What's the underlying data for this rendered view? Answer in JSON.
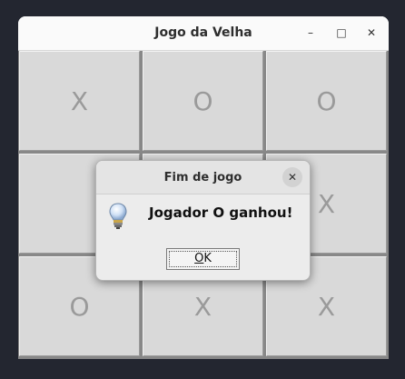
{
  "window": {
    "title": "Jogo da Velha",
    "controls": {
      "minimize": "–",
      "maximize": "□",
      "close": "✕"
    }
  },
  "board": {
    "cells": [
      "X",
      "O",
      "O",
      "",
      "",
      "X",
      "O",
      "X",
      "X"
    ]
  },
  "dialog": {
    "title": "Fim de jogo",
    "close": "✕",
    "message": "Jogador O ganhou!",
    "ok_mnemonic": "O",
    "ok_rest": "K",
    "icon": "lightbulb-icon"
  }
}
